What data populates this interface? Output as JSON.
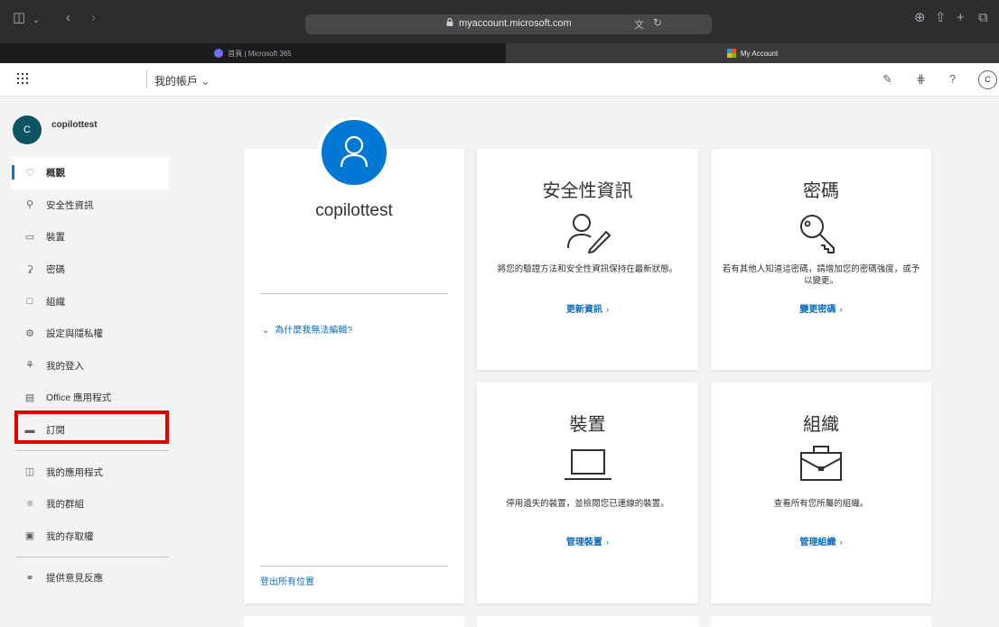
{
  "browser": {
    "url": "myaccount.microsoft.com",
    "tabs": [
      {
        "label": "首頁 | Microsoft 365"
      },
      {
        "label": "My Account"
      }
    ]
  },
  "header": {
    "title": "我的帳戶",
    "avatar_initial": "C"
  },
  "sidebar": {
    "user": {
      "initial": "C",
      "name": "copilottest"
    },
    "items": [
      {
        "label": "概觀",
        "icon": "person-icon",
        "active": true
      },
      {
        "label": "安全性資訊",
        "icon": "security-info-icon"
      },
      {
        "label": "裝置",
        "icon": "laptop-icon"
      },
      {
        "label": "密碼",
        "icon": "key-icon"
      },
      {
        "label": "組織",
        "icon": "briefcase-icon"
      },
      {
        "label": "設定與隱私權",
        "icon": "gear-icon"
      },
      {
        "label": "我的登入",
        "icon": "signin-icon"
      },
      {
        "label": "Office 應用程式",
        "icon": "office-apps-icon"
      },
      {
        "label": "訂閱",
        "icon": "subscription-icon"
      },
      {
        "label": "我的應用程式",
        "icon": "my-apps-icon"
      },
      {
        "label": "我的群組",
        "icon": "groups-icon"
      },
      {
        "label": "我的存取權",
        "icon": "access-icon"
      },
      {
        "label": "提供意見反應",
        "icon": "feedback-icon"
      }
    ]
  },
  "profile": {
    "name": "copilottest",
    "why_edit": "為什麼我無法編輯?",
    "signout": "登出所有位置"
  },
  "tiles": {
    "security": {
      "title": "安全性資訊",
      "desc": "將您的驗證方法和安全性資訊保持在最新狀態。",
      "link": "更新資訊"
    },
    "password": {
      "title": "密碼",
      "desc": "若有其他人知道這密碼，請增加您的密碼強度，或予以變更。",
      "link": "變更密碼"
    },
    "devices": {
      "title": "裝置",
      "desc": "停用遺失的裝置，並檢閱您已連線的裝置。",
      "link": "管理裝置"
    },
    "organizations": {
      "title": "組織",
      "desc": "查看所有您所屬的組織。",
      "link": "管理組織"
    }
  },
  "colors": {
    "accent": "#0078d4",
    "link": "#0f6cbd",
    "highlight": "#e00000",
    "avatar_bg": "#0b5563"
  }
}
